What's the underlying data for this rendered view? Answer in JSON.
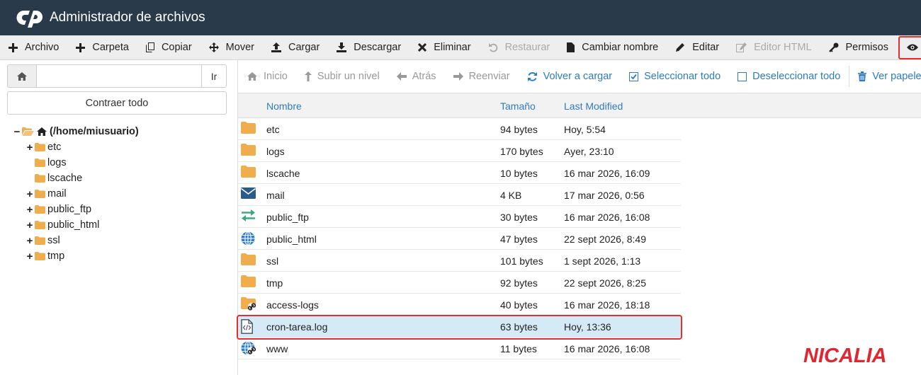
{
  "header": {
    "title": "Administrador de archivos"
  },
  "toolbar": [
    {
      "label": "Archivo",
      "icon": "plus-icon",
      "name": "new-file-button",
      "disabled": false
    },
    {
      "label": "Carpeta",
      "icon": "plus-icon",
      "name": "new-folder-button",
      "disabled": false
    },
    {
      "label": "Copiar",
      "icon": "copy-icon",
      "name": "copy-button",
      "disabled": false
    },
    {
      "label": "Mover",
      "icon": "move-icon",
      "name": "move-button",
      "disabled": false
    },
    {
      "label": "Cargar",
      "icon": "upload-icon",
      "name": "upload-button",
      "disabled": false
    },
    {
      "label": "Descargar",
      "icon": "download-icon",
      "name": "download-button",
      "disabled": false
    },
    {
      "label": "Eliminar",
      "icon": "x-icon",
      "name": "delete-button",
      "disabled": false
    },
    {
      "label": "Restaurar",
      "icon": "undo-icon",
      "name": "restore-button",
      "disabled": true
    },
    {
      "label": "Cambiar nombre",
      "icon": "file-icon",
      "name": "rename-button",
      "disabled": false
    },
    {
      "label": "Editar",
      "icon": "pencil-icon",
      "name": "edit-button",
      "disabled": false
    },
    {
      "label": "Editor HTML",
      "icon": "edit-square-icon",
      "name": "html-editor-button",
      "disabled": true
    },
    {
      "label": "Permisos",
      "icon": "key-icon",
      "name": "permissions-button",
      "disabled": false
    },
    {
      "label": "Ver",
      "icon": "eye-icon",
      "name": "view-button",
      "disabled": false
    }
  ],
  "path_bar": {
    "value": "",
    "go_label": "Ir"
  },
  "collapse_label": "Contraer todo",
  "tree": {
    "root": "(/home/miusuario)",
    "items": [
      {
        "label": "etc",
        "expandable": true
      },
      {
        "label": "logs",
        "expandable": false
      },
      {
        "label": "lscache",
        "expandable": false
      },
      {
        "label": "mail",
        "expandable": true
      },
      {
        "label": "public_ftp",
        "expandable": true
      },
      {
        "label": "public_html",
        "expandable": true
      },
      {
        "label": "ssl",
        "expandable": true
      },
      {
        "label": "tmp",
        "expandable": true
      }
    ]
  },
  "nav": [
    {
      "label": "Inicio",
      "icon": "home-icon",
      "active": false
    },
    {
      "label": "Subir un nivel",
      "icon": "level-up-icon",
      "active": false
    },
    {
      "label": "Atrás",
      "icon": "arrow-left-icon",
      "active": false
    },
    {
      "label": "Reenviar",
      "icon": "arrow-right-icon",
      "active": false
    },
    {
      "label": "Volver a cargar",
      "icon": "refresh-icon",
      "active": true
    },
    {
      "label": "Seleccionar todo",
      "icon": "check-square-icon",
      "active": true
    },
    {
      "label": "Deseleccionar todo",
      "icon": "square-icon",
      "active": true
    },
    {
      "label": "Ver papelera",
      "icon": "trash-icon",
      "active": true
    }
  ],
  "table": {
    "columns": [
      "Nombre",
      "Tamaño",
      "Last Modified"
    ],
    "rows": [
      {
        "name": "etc",
        "size": "94 bytes",
        "date": "Hoy, 5:54",
        "icon": "folder-icon"
      },
      {
        "name": "logs",
        "size": "170 bytes",
        "date": "Ayer, 23:10",
        "icon": "folder-icon"
      },
      {
        "name": "lscache",
        "size": "10 bytes",
        "date": "16 mar 2026, 16:09",
        "icon": "folder-icon"
      },
      {
        "name": "mail",
        "size": "4 KB",
        "date": "17 mar 2026, 0:56",
        "icon": "mail-icon"
      },
      {
        "name": "public_ftp",
        "size": "30 bytes",
        "date": "16 mar 2026, 16:08",
        "icon": "exchange-icon"
      },
      {
        "name": "public_html",
        "size": "47 bytes",
        "date": "22 sept 2026, 8:49",
        "icon": "globe-icon"
      },
      {
        "name": "ssl",
        "size": "101 bytes",
        "date": "1 sept 2026, 1:13",
        "icon": "folder-icon"
      },
      {
        "name": "tmp",
        "size": "92 bytes",
        "date": "22 sept 2026, 8:25",
        "icon": "folder-icon"
      },
      {
        "name": "access-logs",
        "size": "40 bytes",
        "date": "16 mar 2026, 18:18",
        "icon": "folder-link-icon"
      },
      {
        "name": "cron-tarea.log",
        "size": "63 bytes",
        "date": "Hoy, 13:36",
        "icon": "code-file-icon",
        "selected": true
      },
      {
        "name": "www",
        "size": "11 bytes",
        "date": "16 mar 2026, 16:08",
        "icon": "globe-link-icon"
      }
    ]
  },
  "colors": {
    "header_bg": "#293a4a",
    "accent": "#2e7bc0",
    "folder": "#f0ad4e",
    "highlight": "#e03030",
    "selected_row": "#d4ebf7"
  },
  "brand": {
    "text": "NICALIA"
  }
}
